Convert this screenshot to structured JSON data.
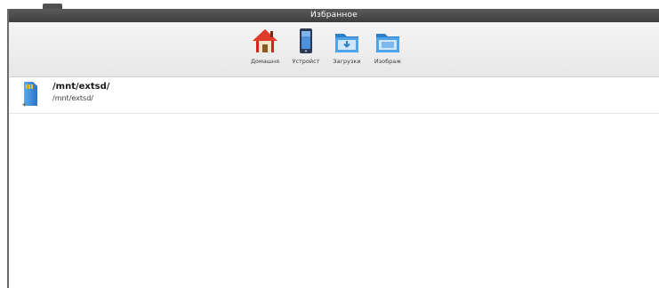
{
  "window": {
    "title": "Избранное"
  },
  "favorites": [
    {
      "label": "Домашня",
      "icon": "home-icon"
    },
    {
      "label": "Устройст",
      "icon": "device-phone-icon"
    },
    {
      "label": "Загрузки",
      "icon": "downloads-folder-icon"
    },
    {
      "label": "Изображ",
      "icon": "images-folder-icon"
    }
  ],
  "list": {
    "items": [
      {
        "title": "/mnt/extsd/",
        "path": "/mnt/extsd/",
        "icon": "sd-card-icon"
      }
    ]
  },
  "colors": {
    "titlebar": "#4a4a4a",
    "folder_blue": "#3f8ed6",
    "house_roof": "#c8281e"
  }
}
